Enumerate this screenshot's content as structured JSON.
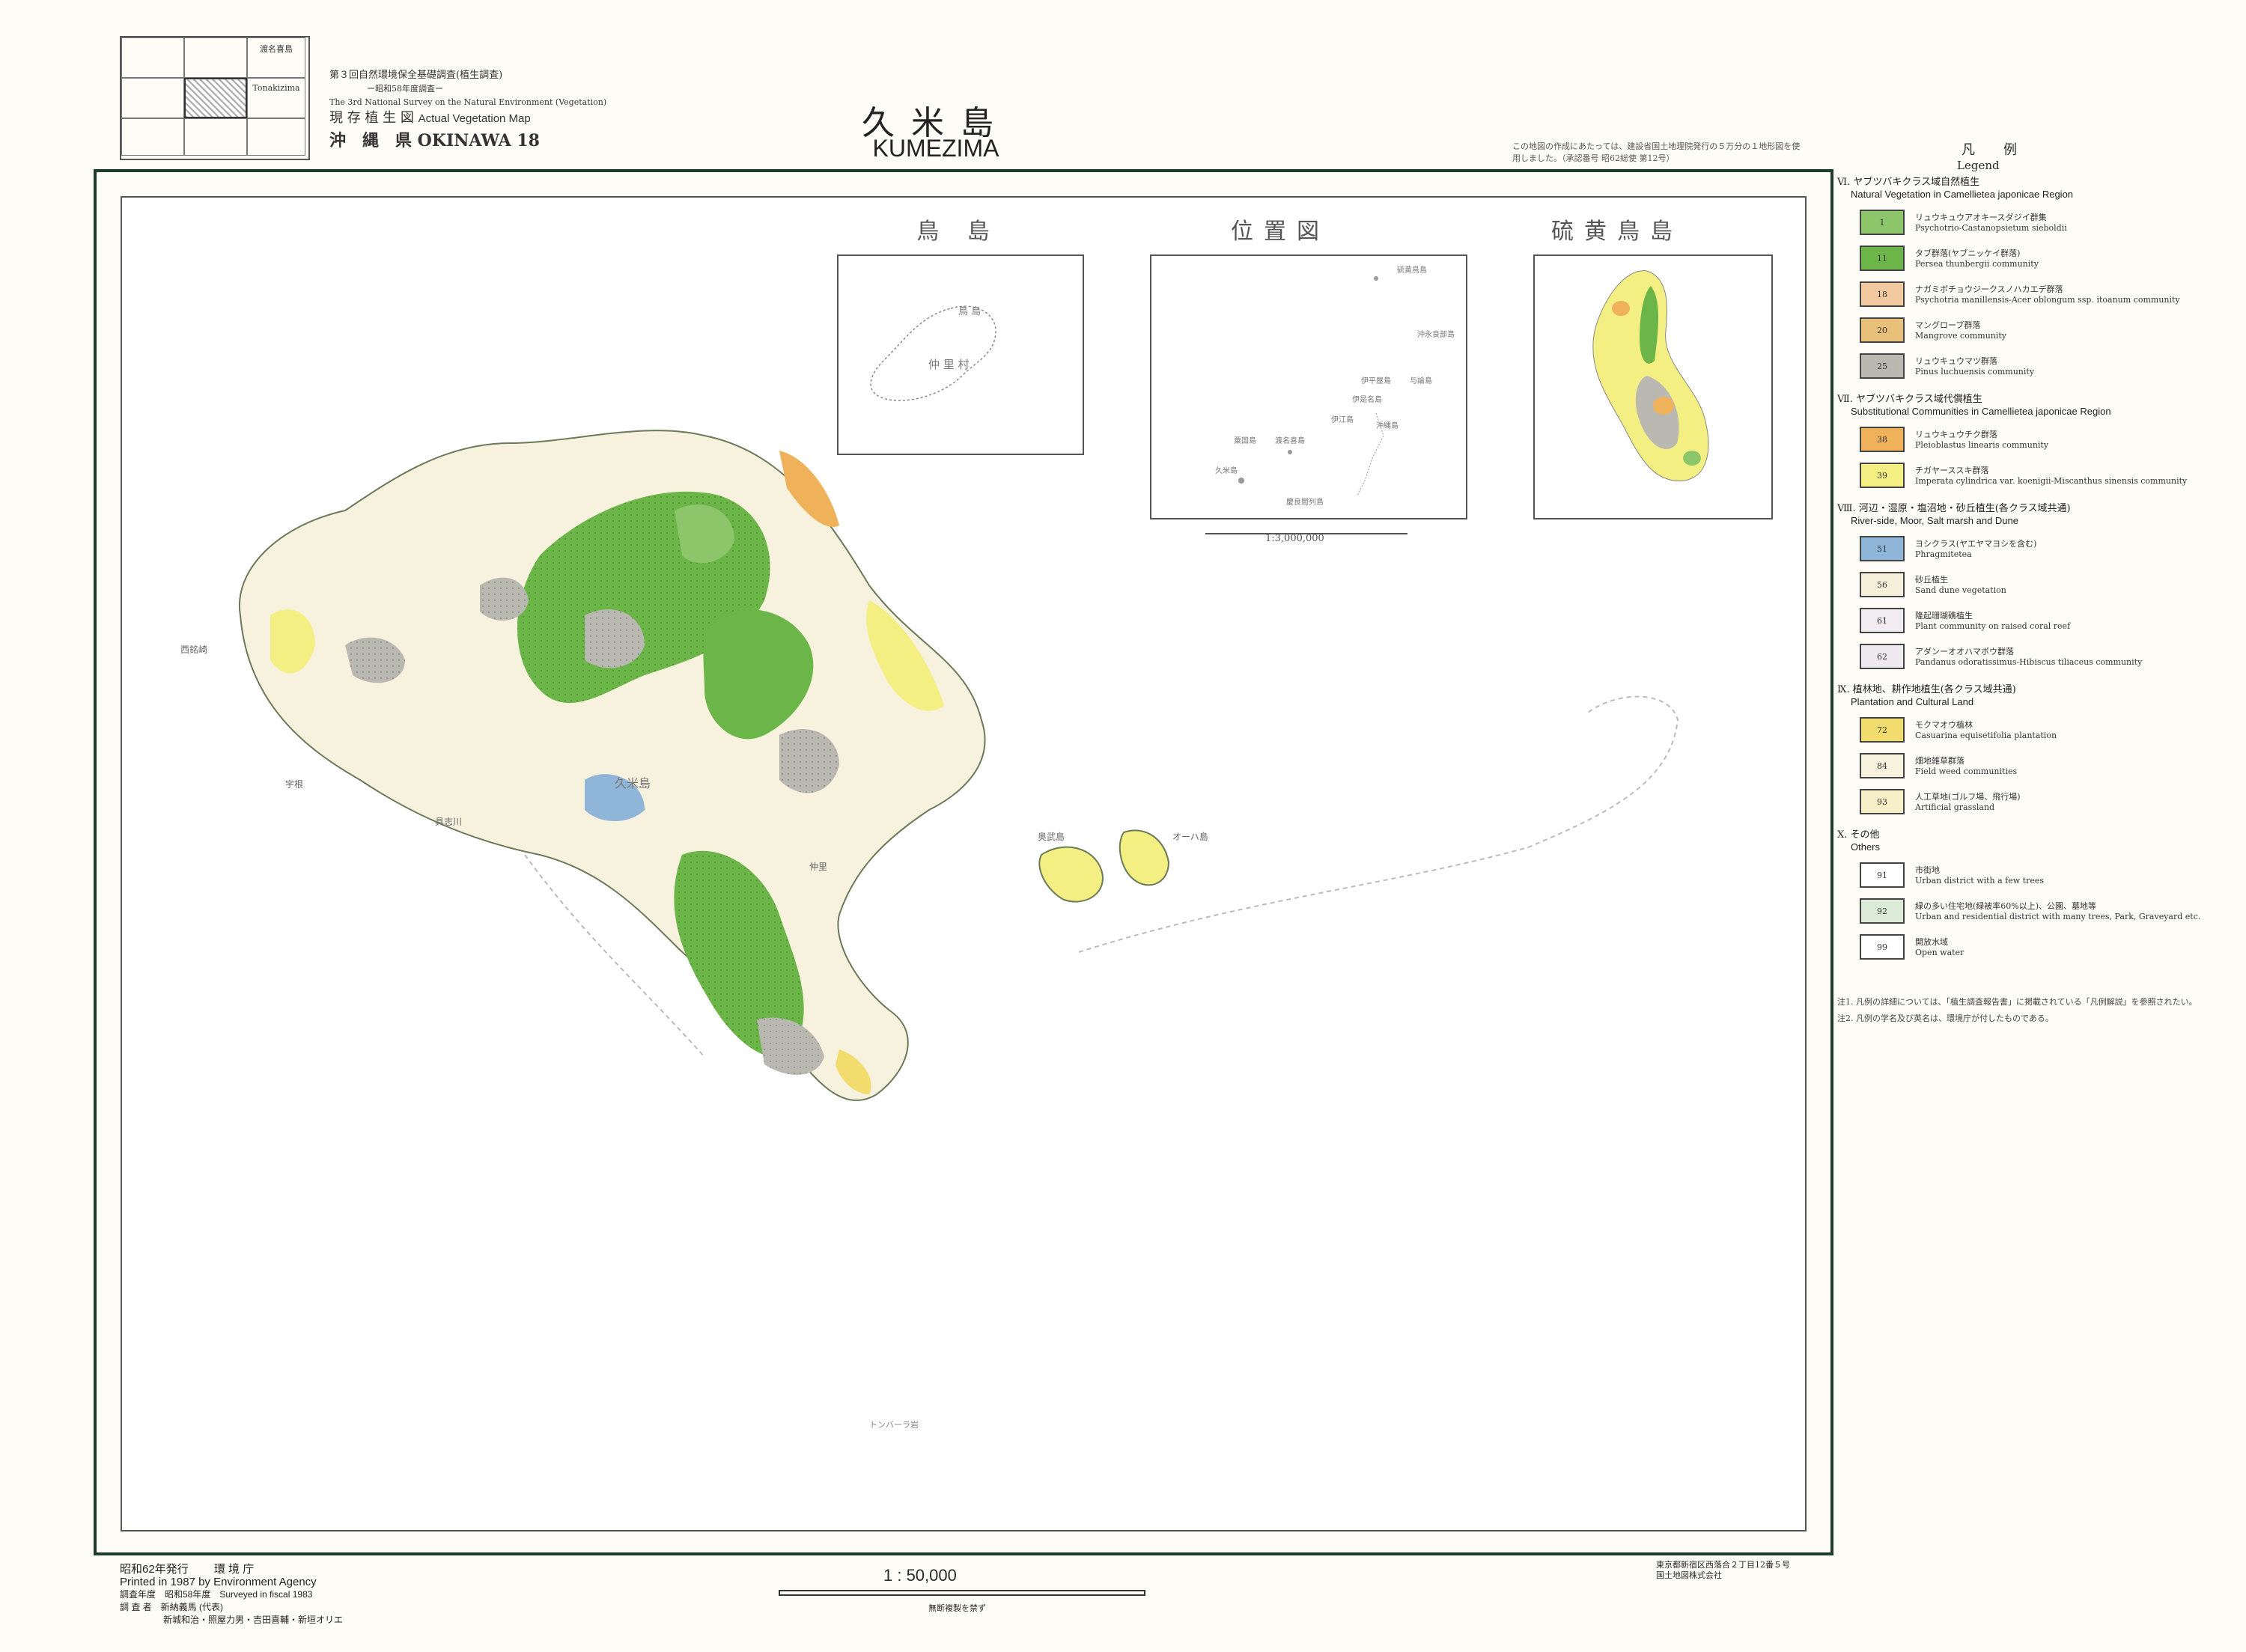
{
  "index_sheet": {
    "name_ja": "渡名喜島",
    "name_en": "Tonakizima"
  },
  "header": {
    "survey_ja": "第３回自然環境保全基礎調査(植生調査)",
    "survey_year": "ー昭和58年度調査ー",
    "survey_en": "The 3rd National Survey on the Natural Environment (Vegetation)",
    "map_type_ja": "現 存 植 生 図",
    "map_type_en": "Actual Vegetation Map",
    "prefecture": "沖　縄　県 OKINAWA 18",
    "title_ja": "久米島",
    "title_en": "KUMEZIMA",
    "note": "この地図の作成にあたっては、建設省国土地理院発行の５万分の１地形図を使用しました。（承認番号 昭62総使 第12号）"
  },
  "insets": [
    {
      "title": "鳥 島",
      "label1": "鳥 島",
      "label2": "仲 里 村"
    },
    {
      "title": "位置図",
      "scale": "1:3,000,000",
      "places": [
        "硫黄鳥島",
        "沖永良部島",
        "与論島",
        "伊平屋島",
        "伊是名島",
        "伊江島",
        "沖縄島",
        "粟国島",
        "渡名喜島",
        "久米島",
        "慶良間列島"
      ]
    },
    {
      "title": "硫黄鳥島"
    }
  ],
  "legend": {
    "title_ja": "凡　例",
    "title_en": "Legend",
    "sections": [
      {
        "head_ja": "Ⅵ. ヤブツバキクラス域自然植生",
        "head_en": "Natural Vegetation in Camellietea japonicae Region",
        "items": [
          {
            "code": "1",
            "ja": "リュウキュウアオキースダジイ群集",
            "en": "Psychotrio-Castanopsietum sieboldii",
            "color": "#8cc56a"
          },
          {
            "code": "11",
            "ja": "タブ群落(ヤブニッケイ群落)",
            "en": "Persea thunbergii community",
            "color": "#6cb548"
          },
          {
            "code": "18",
            "ja": "ナガミボチョウジークスノハカエデ群落",
            "en": "Psychotria manillensis-Acer oblongum ssp. itoanum community",
            "color": "#f3c9a0"
          },
          {
            "code": "20",
            "ja": "マングローブ群落",
            "en": "Mangrove community",
            "color": "#e9c07a"
          },
          {
            "code": "25",
            "ja": "リュウキュウマツ群落",
            "en": "Pinus luchuensis community",
            "color": "#b9b9b1"
          }
        ]
      },
      {
        "head_ja": "Ⅶ. ヤブツバキクラス域代償植生",
        "head_en": "Substitutional Communities in Camellietea japonicae Region",
        "items": [
          {
            "code": "38",
            "ja": "リュウキュウチク群落",
            "en": "Pleioblastus linearis community",
            "color": "#efb25b"
          },
          {
            "code": "39",
            "ja": "チガヤーススキ群落",
            "en": "Imperata cylindrica var. koenigii-Miscanthus sinensis community",
            "color": "#f4ef82"
          }
        ]
      },
      {
        "head_ja": "Ⅷ. 河辺・湿原・塩沼地・砂丘植生(各クラス域共通)",
        "head_en": "River-side, Moor, Salt marsh and Dune",
        "items": [
          {
            "code": "51",
            "ja": "ヨシクラス(ヤエヤマヨシを含む)",
            "en": "Phragmitetea",
            "color": "#8fb5d8"
          },
          {
            "code": "56",
            "ja": "砂丘植生",
            "en": "Sand dune vegetation",
            "color": "#f6efda"
          },
          {
            "code": "61",
            "ja": "隆起珊瑚礁植生",
            "en": "Plant community on raised coral reef",
            "color": "#f0ecf0"
          },
          {
            "code": "62",
            "ja": "アダンーオオハマボウ群落",
            "en": "Pandanus odoratissimus-Hibiscus tiliaceus community",
            "color": "#efe9f0"
          }
        ]
      },
      {
        "head_ja": "Ⅸ. 植林地、耕作地植生(各クラス域共通)",
        "head_en": "Plantation and Cultural Land",
        "items": [
          {
            "code": "72",
            "ja": "モクマオウ植林",
            "en": "Casuarina equisetifolia plantation",
            "color": "#f2dc6e"
          },
          {
            "code": "84",
            "ja": "畑地雑草群落",
            "en": "Field weed communities",
            "color": "#f7f2de"
          },
          {
            "code": "93",
            "ja": "人工草地(ゴルフ場、飛行場)",
            "en": "Artificial grassland",
            "color": "#f6efc8"
          }
        ]
      },
      {
        "head_ja": "Ⅹ. その他",
        "head_en": "Others",
        "items": [
          {
            "code": "91",
            "ja": "市街地",
            "en": "Urban district with a few trees",
            "color": "#ffffff"
          },
          {
            "code": "92",
            "ja": "緑の多い住宅地(緑被率60%以上)、公園、墓地等",
            "en": "Urban and residential district with many trees, Park, Graveyard etc.",
            "color": "#dcebd8"
          },
          {
            "code": "99",
            "ja": "開放水域",
            "en": "Open water",
            "color": "#ffffff"
          }
        ]
      }
    ],
    "notes": [
      "注1. 凡例の詳細については、「植生調査報告書」に掲載されている「凡例解説」を参照されたい。",
      "注2. 凡例の学名及び英名は、環境庁が付したものである。"
    ]
  },
  "map_labels": {
    "island_main": "久米島",
    "place1": "西銘崎",
    "place2": "宇根",
    "place3": "具志川",
    "place4": "仲里",
    "islet1": "奥武島",
    "islet2": "オーハ島",
    "sea_label": "トンバーラ岩"
  },
  "footer": {
    "issued_ja": "昭和62年発行",
    "agency_ja": "環 境 庁",
    "printed_en": "Printed in 1987 by Environment Agency",
    "surveyed": "調査年度　昭和58年度　Surveyed in fiscal 1983",
    "surveyors": "調 査 者　新納義馬 (代表)",
    "surveyors2": "新城和治・照屋力男・吉田喜輔・新垣オリエ",
    "scale": "1 : 50,000",
    "scale_note": "無断複製を禁ず",
    "printer1": "東京都新宿区西落合２丁目12番５号",
    "printer2": "国土地図株式会社"
  },
  "colors": {
    "forest": "#6cb548",
    "forest_light": "#a9d27e",
    "pine": "#b9b9b1",
    "grass": "#f4ef82",
    "field": "#f7f2de",
    "bamboo": "#efb25b",
    "frame": "#1f3b2a"
  }
}
